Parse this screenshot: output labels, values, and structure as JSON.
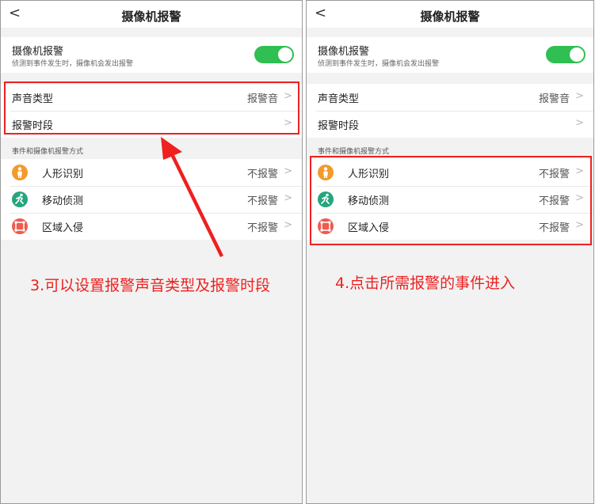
{
  "panels": [
    {
      "nav": {
        "back": "<",
        "title": "摄像机报警"
      },
      "alarm": {
        "title": "摄像机报警",
        "desc": "侦测到事件发生时，摄像机会发出报警"
      },
      "settings": [
        {
          "label": "声音类型",
          "value": "报警音",
          "chevron": ">"
        },
        {
          "label": "报警时段",
          "value": "",
          "chevron": ">"
        }
      ],
      "section_title": "事件和摄像机报警方式",
      "events": [
        {
          "icon": "person-icon",
          "label": "人形识别",
          "value": "不报警",
          "chevron": ">"
        },
        {
          "icon": "motion-icon",
          "label": "移动侦测",
          "value": "不报警",
          "chevron": ">"
        },
        {
          "icon": "area-icon",
          "label": "区域入侵",
          "value": "不报警",
          "chevron": ">"
        }
      ],
      "annotation": "3.可以设置报警声音类型及报警时段"
    },
    {
      "nav": {
        "back": "<",
        "title": "摄像机报警"
      },
      "alarm": {
        "title": "摄像机报警",
        "desc": "侦测到事件发生时，摄像机会发出报警"
      },
      "settings": [
        {
          "label": "声音类型",
          "value": "报警音",
          "chevron": ">"
        },
        {
          "label": "报警时段",
          "value": "",
          "chevron": ">"
        }
      ],
      "section_title": "事件和摄像机报警方式",
      "events": [
        {
          "icon": "person-icon",
          "label": "人形识别",
          "value": "不报警",
          "chevron": ">"
        },
        {
          "icon": "motion-icon",
          "label": "移动侦测",
          "value": "不报警",
          "chevron": ">"
        },
        {
          "icon": "area-icon",
          "label": "区域入侵",
          "value": "不报警",
          "chevron": ">"
        }
      ],
      "annotation": "4.点击所需报警的事件进入"
    }
  ],
  "colors": {
    "toggle_on": "#2fbf52",
    "highlight": "#ee2020",
    "person_icon": "#f39a2b",
    "motion_icon": "#26a57e",
    "area_icon": "#ee5b4f"
  }
}
